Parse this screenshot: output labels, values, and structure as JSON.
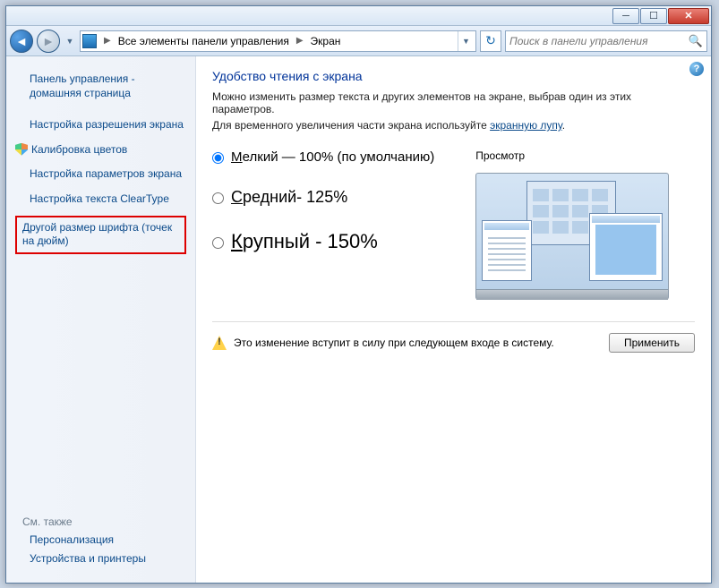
{
  "titlebar": {},
  "navbar": {
    "path_root": "Все элементы панели управления",
    "path_leaf": "Экран",
    "search_placeholder": "Поиск в панели управления"
  },
  "sidebar": {
    "home": "Панель управления - домашняя страница",
    "items": [
      "Настройка разрешения экрана",
      "Калибровка цветов",
      "Настройка параметров экрана",
      "Настройка текста ClearType",
      "Другой размер шрифта (точек на дюйм)"
    ],
    "seealso_header": "См. также",
    "seealso": [
      "Персонализация",
      "Устройства и принтеры"
    ]
  },
  "main": {
    "title": "Удобство чтения с экрана",
    "desc1": "Можно изменить размер текста и других элементов на экране, выбрав один из этих параметров.",
    "desc2_a": "Для временного увеличения части экрана используйте ",
    "desc2_link": "экранную лупу",
    "desc2_b": ".",
    "opt_small": "Мелкий — 100% (по умолчанию)",
    "opt_medium": "Средний- 125%",
    "opt_large": "Крупный  -  150%",
    "preview_label": "Просмотр",
    "warning": "Это изменение вступит в силу при следующем входе в систему.",
    "apply": "Применить"
  }
}
